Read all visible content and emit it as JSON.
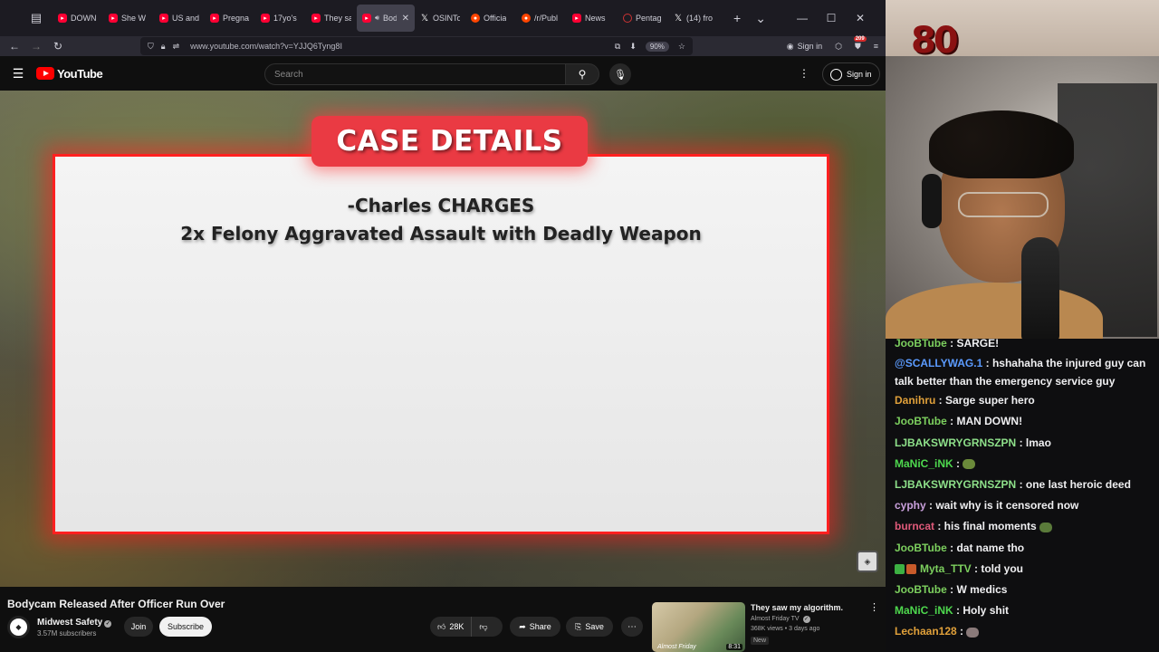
{
  "browser": {
    "tabs": [
      {
        "title": "DOWN",
        "icon": "youtube-icon"
      },
      {
        "title": "She W",
        "icon": "youtube-icon"
      },
      {
        "title": "US and",
        "icon": "youtube-icon"
      },
      {
        "title": "Pregna",
        "icon": "youtube-icon"
      },
      {
        "title": "17yo's",
        "icon": "youtube-icon"
      },
      {
        "title": "They sa",
        "icon": "youtube-icon"
      },
      {
        "title": "Bod",
        "icon": "youtube-icon",
        "active": true
      },
      {
        "title": "OSINTo",
        "icon": "x-icon"
      },
      {
        "title": "Officia",
        "icon": "reddit-icon"
      },
      {
        "title": "/r/Publ",
        "icon": "reddit-icon"
      },
      {
        "title": "News",
        "icon": "youtube-icon"
      },
      {
        "title": "Pentag",
        "icon": "pentagon-icon"
      },
      {
        "title": "(14) fro",
        "icon": "x-icon"
      }
    ],
    "url": "www.youtube.com/watch?v=YJJQ6Tyng8I",
    "zoom": "90%",
    "sign_in": "Sign in",
    "notification_count": "209"
  },
  "youtube": {
    "logo_text": "YouTube",
    "search_placeholder": "Search",
    "sign_in": "Sign in"
  },
  "video_frame": {
    "heading": "CASE DETAILS",
    "line1": "-Charles CHARGES",
    "line2": "2x Felony Aggravated Assault with Deadly Weapon"
  },
  "video_info": {
    "title": "Bodycam Released After Officer Run Over",
    "channel": "Midwest Safety",
    "subscribers": "3.57M subscribers",
    "join_label": "Join",
    "subscribe_label": "Subscribe",
    "likes": "28K",
    "share_label": "Share",
    "save_label": "Save"
  },
  "recommended": {
    "title": "They saw my algorithm.",
    "channel": "Almost Friday TV",
    "meta": "368K views • 3 days ago",
    "badge": "New",
    "duration": "8:31",
    "thumb_text": "Almost Friday"
  },
  "stream_overlay": {
    "number": "80"
  },
  "chat": [
    {
      "user": "JooBTube",
      "color": "#7ccf5e",
      "text": " : SARGE!"
    },
    {
      "user": "@SCALLYWAG.1",
      "color": "#5b9bff",
      "text": " : hshahaha the injured guy can talk better than the emergency service guy",
      "wrap": true
    },
    {
      "user": "Danihru",
      "color": "#e0a03a",
      "text": " : Sarge super hero"
    },
    {
      "user": "JooBTube",
      "color": "#7ccf5e",
      "text": " : MAN DOWN!"
    },
    {
      "user": "LJBAKSWRYGRNSZPN",
      "color": "#8ee08a",
      "text": " : lmao"
    },
    {
      "user": "MaNiC_iNK",
      "color": "#4ed84e",
      "text": " : ",
      "emote": "#6b8a3a"
    },
    {
      "user": "LJBAKSWRYGRNSZPN",
      "color": "#8ee08a",
      "text": " : one last heroic deed"
    },
    {
      "user": "cyphy",
      "color": "#c9a0dc",
      "text": " : wait why is it censored now"
    },
    {
      "user": "burncat",
      "color": "#e05a7a",
      "text": " : his final moments ",
      "emote": "#5a7a3a"
    },
    {
      "user": "JooBTube",
      "color": "#7ccf5e",
      "text": " : dat name tho"
    },
    {
      "user": "Myta_TTV",
      "color": "#7ccf5e",
      "text": " : told you",
      "prefix_badges": true
    },
    {
      "user": "JooBTube",
      "color": "#7ccf5e",
      "text": " : W medics"
    },
    {
      "user": "MaNiC_iNK",
      "color": "#4ed84e",
      "text": " : Holy shit"
    },
    {
      "user": "Lechaan128",
      "color": "#e0a03a",
      "text": " : ",
      "emote": "#8a7a7a"
    }
  ]
}
